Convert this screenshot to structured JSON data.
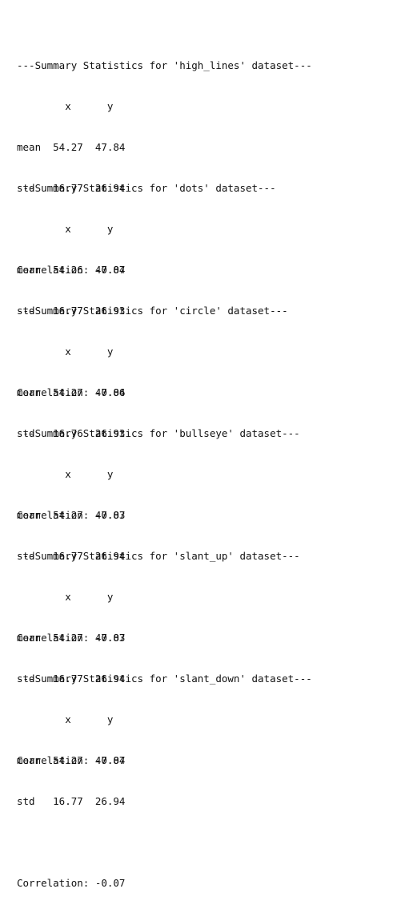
{
  "output": {
    "blocks": [
      {
        "header": "---Summary Statistics for 'high_lines' dataset---",
        "columns": "        x      y",
        "mean": "mean  54.27  47.84",
        "std": "std   16.77  26.94",
        "correlation": "Correlation: -0.07"
      },
      {
        "header": "---Summary Statistics for 'dots' dataset---",
        "columns": "        x      y",
        "mean": "mean  54.26  47.84",
        "std": "std   16.77  26.93",
        "correlation": "Correlation: -0.06"
      },
      {
        "header": "---Summary Statistics for 'circle' dataset---",
        "columns": "        x      y",
        "mean": "mean  54.27  47.84",
        "std": "std   16.76  26.93",
        "correlation": "Correlation: -0.07"
      },
      {
        "header": "---Summary Statistics for 'bullseye' dataset---",
        "columns": "        x      y",
        "mean": "mean  54.27  47.83",
        "std": "std   16.77  26.94",
        "correlation": "Correlation: -0.07"
      },
      {
        "header": "---Summary Statistics for 'slant_up' dataset---",
        "columns": "        x      y",
        "mean": "mean  54.27  47.83",
        "std": "std   16.77  26.94",
        "correlation": "Correlation: -0.07"
      },
      {
        "header": "---Summary Statistics for 'slant_down' dataset---",
        "columns": "        x      y",
        "mean": "mean  54.27  47.84",
        "std": "std   16.77  26.94",
        "correlation": "Correlation: -0.07"
      }
    ]
  }
}
